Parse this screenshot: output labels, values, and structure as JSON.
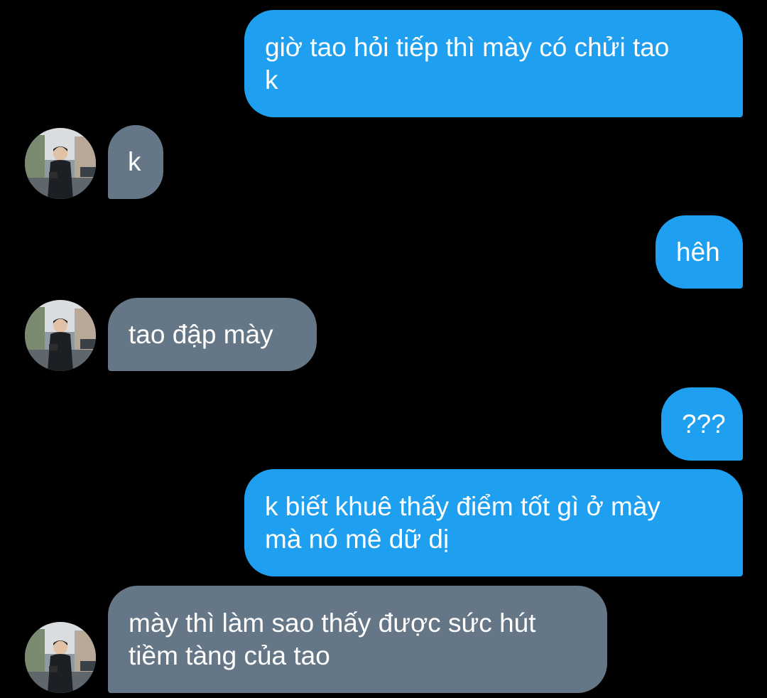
{
  "theme": {
    "background": "#000000",
    "sent_bubble_color": "#1f9ff0",
    "received_bubble_color": "#657686",
    "text_color": "#ffffff"
  },
  "contact": {
    "avatar_icon": "person-photo-avatar"
  },
  "messages": [
    {
      "direction": "sent",
      "text": "giờ tao hỏi tiếp thì mày có chửi tao\nk"
    },
    {
      "direction": "received",
      "text": "k"
    },
    {
      "direction": "sent",
      "text": "hêh"
    },
    {
      "direction": "received",
      "text": "tao đập mày"
    },
    {
      "direction": "sent",
      "text": "???"
    },
    {
      "direction": "sent",
      "text": "k biết khuê thấy điểm tốt gì ở mày\nmà nó mê dữ dị"
    },
    {
      "direction": "received",
      "text": "mày thì làm sao thấy được sức hút\ntiềm tàng của tao"
    }
  ]
}
